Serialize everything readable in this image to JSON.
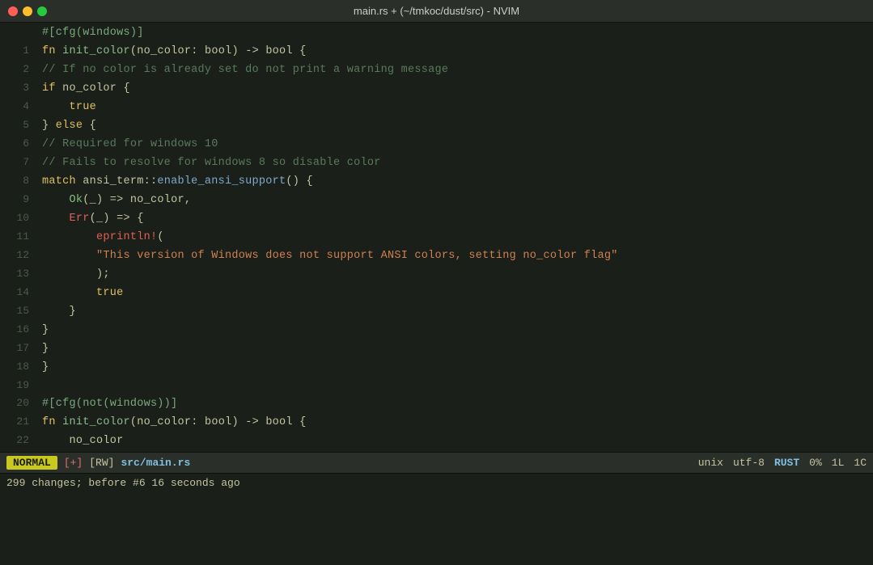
{
  "titlebar": {
    "title": "main.rs + (~/tmkoc/dust/src) - NVIM"
  },
  "traffic_lights": {
    "red": "red",
    "yellow": "yellow",
    "green": "green"
  },
  "lines": [
    {
      "num": "",
      "tokens": [
        {
          "t": "#[cfg(windows)]",
          "c": "c-attribute"
        }
      ]
    },
    {
      "num": "1",
      "tokens": [
        {
          "t": "fn ",
          "c": "c-keyword"
        },
        {
          "t": "init_color",
          "c": "c-fn-name"
        },
        {
          "t": "(",
          "c": "c-punct"
        },
        {
          "t": "no_color",
          "c": "c-ident"
        },
        {
          "t": ": ",
          "c": "c-punct"
        },
        {
          "t": "bool",
          "c": "c-type"
        },
        {
          "t": ") -> ",
          "c": "c-punct"
        },
        {
          "t": "bool",
          "c": "c-type"
        },
        {
          "t": " {",
          "c": "c-punct"
        }
      ]
    },
    {
      "num": "2",
      "tokens": [
        {
          "t": "// If no color is already set do not print a warning message",
          "c": "c-comment"
        }
      ]
    },
    {
      "num": "3",
      "tokens": [
        {
          "t": "if ",
          "c": "c-keyword"
        },
        {
          "t": "no_color {",
          "c": "c-ident"
        }
      ]
    },
    {
      "num": "4",
      "tokens": [
        {
          "t": "true",
          "c": "c-true"
        }
      ]
    },
    {
      "num": "5",
      "tokens": [
        {
          "t": "} ",
          "c": "c-brace"
        },
        {
          "t": "else",
          "c": "c-keyword"
        },
        {
          "t": " {",
          "c": "c-brace"
        }
      ]
    },
    {
      "num": "6",
      "tokens": [
        {
          "t": "// Required for windows 10",
          "c": "c-comment"
        }
      ]
    },
    {
      "num": "7",
      "tokens": [
        {
          "t": "// Fails to resolve for windows 8 so disable color",
          "c": "c-comment"
        }
      ]
    },
    {
      "num": "8",
      "tokens": [
        {
          "t": "match ",
          "c": "c-keyword"
        },
        {
          "t": "ansi_term",
          "c": "c-ident"
        },
        {
          "t": "::",
          "c": "c-punct"
        },
        {
          "t": "enable_ansi_support",
          "c": "c-method"
        },
        {
          "t": "() {",
          "c": "c-punct"
        }
      ]
    },
    {
      "num": "9",
      "tokens": [
        {
          "t": "Ok",
          "c": "c-ok"
        },
        {
          "t": "(_) => ",
          "c": "c-punct"
        },
        {
          "t": "no_color",
          "c": "c-ident"
        },
        {
          "t": ",",
          "c": "c-punct"
        }
      ]
    },
    {
      "num": "10",
      "tokens": [
        {
          "t": "Err",
          "c": "c-err"
        },
        {
          "t": "(_) => {",
          "c": "c-punct"
        }
      ]
    },
    {
      "num": "11",
      "tokens": [
        {
          "t": "eprintln!",
          "c": "c-macro"
        },
        {
          "t": "(",
          "c": "c-punct"
        }
      ]
    },
    {
      "num": "12",
      "tokens": [
        {
          "t": "\"This version of Windows does not support ANSI colors, setting no_color flag\"",
          "c": "c-string"
        }
      ]
    },
    {
      "num": "13",
      "tokens": [
        {
          "t": ");",
          "c": "c-punct"
        }
      ]
    },
    {
      "num": "14",
      "tokens": [
        {
          "t": "true",
          "c": "c-true"
        }
      ]
    },
    {
      "num": "15",
      "tokens": [
        {
          "t": "}",
          "c": "c-brace"
        }
      ]
    },
    {
      "num": "16",
      "tokens": [
        {
          "t": "}",
          "c": "c-brace"
        }
      ]
    },
    {
      "num": "17",
      "tokens": [
        {
          "t": "}",
          "c": "c-brace"
        }
      ]
    },
    {
      "num": "18",
      "tokens": [
        {
          "t": "}",
          "c": "c-brace"
        }
      ]
    },
    {
      "num": "19",
      "tokens": []
    },
    {
      "num": "20",
      "tokens": [
        {
          "t": "#[cfg(not(windows))]",
          "c": "c-attribute"
        }
      ]
    },
    {
      "num": "21",
      "tokens": [
        {
          "t": "fn ",
          "c": "c-keyword"
        },
        {
          "t": "init_color",
          "c": "c-fn-name"
        },
        {
          "t": "(",
          "c": "c-punct"
        },
        {
          "t": "no_color",
          "c": "c-ident"
        },
        {
          "t": ": ",
          "c": "c-punct"
        },
        {
          "t": "bool",
          "c": "c-type"
        },
        {
          "t": ") -> ",
          "c": "c-punct"
        },
        {
          "t": "bool",
          "c": "c-type"
        },
        {
          "t": " {",
          "c": "c-punct"
        }
      ]
    },
    {
      "num": "22",
      "tokens": [
        {
          "t": "no_color",
          "c": "c-ident"
        }
      ]
    }
  ],
  "statusline": {
    "mode": "NORMAL",
    "modified": "[+]",
    "rw": "[RW]",
    "filename": "src/main.rs",
    "fileformat": "unix",
    "encoding": "utf-8",
    "filetype": "RUST",
    "percent": "0%",
    "line": "1L",
    "col": "1C"
  },
  "cmdline": {
    "text": "299 changes; before #6  16 seconds ago"
  },
  "indents": {
    "4": "    ",
    "9": "    ",
    "10": "    ",
    "11": "        ",
    "12": "        ",
    "13": "        ",
    "14": "        ",
    "15": "    ",
    "22": "    "
  }
}
